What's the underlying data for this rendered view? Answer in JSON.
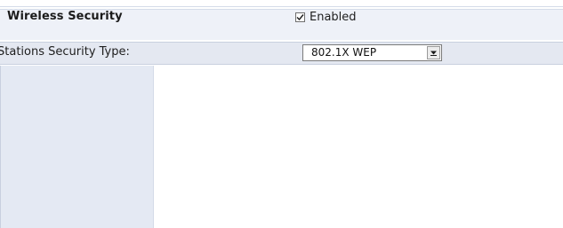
{
  "wireless_security": {
    "title": "Wireless Security",
    "enabled_checked": true,
    "enabled_label": "Enabled"
  },
  "stations_security": {
    "label": "Stations Security Type:",
    "selected_value": "802.1X WEP"
  },
  "icons": {
    "checkbox_mark": "check-icon",
    "dropdown_arrow": "chevron-down-icon"
  },
  "colors": {
    "row_highlight": "#e4e8f1",
    "sidebar": "#e4e9f3",
    "text": "#1e1e1e"
  }
}
